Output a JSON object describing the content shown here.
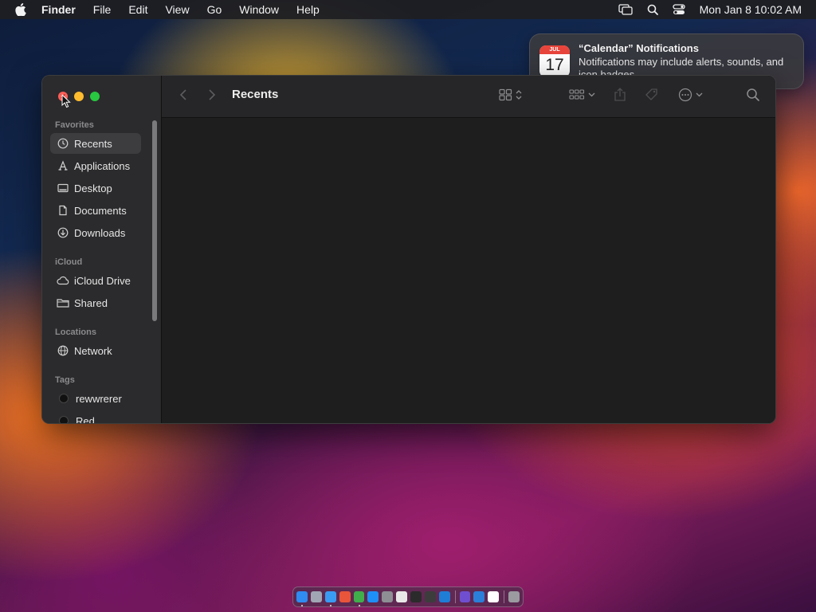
{
  "menubar": {
    "app_name": "Finder",
    "menus": [
      "File",
      "Edit",
      "View",
      "Go",
      "Window",
      "Help"
    ],
    "clock": "Mon Jan 8  10:02 AM",
    "status_icons": [
      "screen-mirroring-icon",
      "spotlight-search-icon",
      "control-center-icon"
    ]
  },
  "notification": {
    "title": "“Calendar” Notifications",
    "body": "Notifications may include alerts, sounds, and icon badges.",
    "icon": {
      "month": "JUL",
      "day": "17"
    }
  },
  "finder": {
    "title": "Recents",
    "sidebar": {
      "favorites_label": "Favorites",
      "favorites": [
        {
          "label": "Recents",
          "icon": "clock-icon",
          "selected": true
        },
        {
          "label": "Applications",
          "icon": "applications-icon"
        },
        {
          "label": "Desktop",
          "icon": "desktop-icon"
        },
        {
          "label": "Documents",
          "icon": "document-icon"
        },
        {
          "label": "Downloads",
          "icon": "download-icon"
        }
      ],
      "icloud_label": "iCloud",
      "icloud": [
        {
          "label": "iCloud Drive",
          "icon": "cloud-icon"
        },
        {
          "label": "Shared",
          "icon": "shared-folder-icon"
        }
      ],
      "locations_label": "Locations",
      "locations": [
        {
          "label": "Network",
          "icon": "globe-icon"
        }
      ],
      "tags_label": "Tags",
      "tags": [
        {
          "label": "rewwrerer",
          "color": "#111111"
        },
        {
          "label": "Red",
          "color": "#111111"
        }
      ]
    }
  },
  "dock": {
    "apps": [
      {
        "name": "finder-icon",
        "color": "#2f8cf0",
        "running": true
      },
      {
        "name": "launchpad-icon",
        "color": "#a0a6b4"
      },
      {
        "name": "safari-icon",
        "color": "#3a9bf2",
        "running": true
      },
      {
        "name": "firefox-icon",
        "color": "#e8553a"
      },
      {
        "name": "chrome-icon",
        "color": "#3fae4b",
        "running": true
      },
      {
        "name": "app-store-icon",
        "color": "#1e8ff7"
      },
      {
        "name": "system-settings-icon",
        "color": "#8d8f95"
      },
      {
        "name": "textedit-icon",
        "color": "#e8e8e8"
      },
      {
        "name": "terminal-icon",
        "color": "#2b2b2b"
      },
      {
        "name": "brush-app-icon",
        "color": "#3c3c3c"
      },
      {
        "name": "vscode-icon",
        "color": "#1f7dd6"
      }
    ],
    "recent_apps": [
      {
        "name": "visual-studio-icon",
        "color": "#6f4fd0"
      },
      {
        "name": "onedrive-icon",
        "color": "#2b7fd9"
      },
      {
        "name": "calendar-icon",
        "color": "#ffffff"
      }
    ],
    "trash": {
      "name": "trash-icon",
      "color": "#9a9aa0"
    }
  }
}
